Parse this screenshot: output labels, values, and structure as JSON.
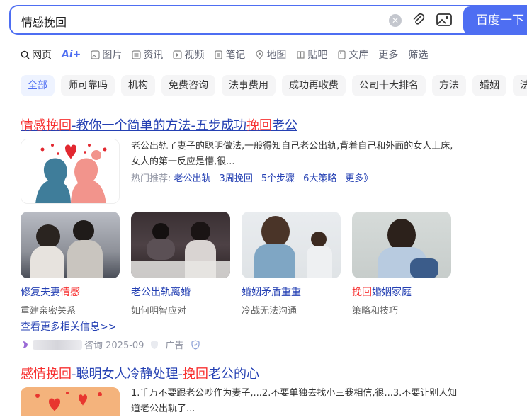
{
  "search": {
    "query": "情感挽回",
    "button_label": "百度一下"
  },
  "tabs": [
    {
      "label": "网页",
      "icon": "search-icon"
    },
    {
      "label": "Ai+",
      "icon": "ai-icon"
    },
    {
      "label": "图片",
      "icon": "image-icon"
    },
    {
      "label": "资讯",
      "icon": "news-icon"
    },
    {
      "label": "视频",
      "icon": "video-icon"
    },
    {
      "label": "笔记",
      "icon": "note-icon"
    },
    {
      "label": "地图",
      "icon": "map-icon"
    },
    {
      "label": "贴吧",
      "icon": "tieba-icon"
    },
    {
      "label": "文库",
      "icon": "doc-icon"
    },
    {
      "label": "更多"
    },
    {
      "label": "筛选"
    }
  ],
  "chips": [
    "全部",
    "师可靠吗",
    "机构",
    "免费咨询",
    "法事费用",
    "成功再收费",
    "公司十大排名",
    "方法",
    "婚姻",
    "法"
  ],
  "result1": {
    "title_pre": "情感挽回",
    "title_mid": "-教你一个简单的方法-五步成功",
    "title_em2": "挽回",
    "title_post": "老公",
    "desc": "老公出轨了妻子的聪明做法,一般得知自己老公出轨,背着自己和外面的女人上床,女人的第一反应是懵,很...",
    "hot_label": "热门推荐:",
    "hot_links": [
      "老公出轨",
      "3周挽回",
      "5个步骤",
      "6大策略",
      "更多》"
    ],
    "cards": [
      {
        "title_a": "修复夫妻",
        "title_em": "情感",
        "title_b": "",
        "sub": "重建亲密关系"
      },
      {
        "title_a": "老公出轨离婚",
        "title_em": "",
        "title_b": "",
        "sub": "如何明智应对"
      },
      {
        "title_a": "婚姻矛盾重重",
        "title_em": "",
        "title_b": "",
        "sub": "冷战无法沟通"
      },
      {
        "title_a": "",
        "title_em": "挽回",
        "title_b": "婚姻家庭",
        "sub": "策略和技巧"
      }
    ],
    "more_link": "查看更多相关信息>>",
    "source_text": "咨询 2025-09",
    "ad_label": "广告"
  },
  "result2": {
    "title_em1": "感情挽回",
    "title_mid": "-聪明女人冷静处理-",
    "title_em2": "挽回",
    "title_post": "老公的心",
    "desc": "1.千万不要跟老公吵作为妻子,...2.不要单独去找小三我相信,很...3.不要让别人知道老公出轨了..."
  },
  "colors": {
    "accent": "#4e6ef2",
    "link": "#2440b3",
    "highlight": "#f73131"
  }
}
